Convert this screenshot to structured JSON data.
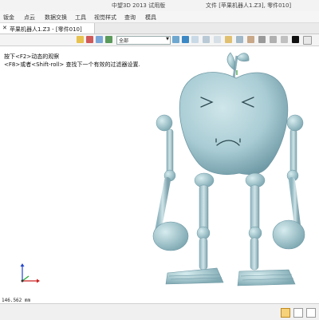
{
  "titlebar": {
    "app_title": "中望3D 2013 试用版",
    "file_info": "文件 [苹果机器人1.Z3], 零件010]"
  },
  "menubar": {
    "items": [
      "钣金",
      "点云",
      "数据交换",
      "工具",
      "视觉样式",
      "查询",
      "模具"
    ]
  },
  "tabs": [
    {
      "label": "苹果机器人1.Z3 - [零件010]"
    }
  ],
  "toolbar": {
    "filter_value": "全部"
  },
  "viewport": {
    "hint_line1": "按下<F2>动态的观察",
    "hint_line2": "<F8>或者<Shift-roll> 查找下一个有效的过滤器设置.",
    "model_color": "#a9ccd4",
    "axis_colors": {
      "x": "#cc2222",
      "y": "#22aa33",
      "z": "#2244cc"
    }
  },
  "status": {
    "coordinate": "146.562 mm"
  }
}
